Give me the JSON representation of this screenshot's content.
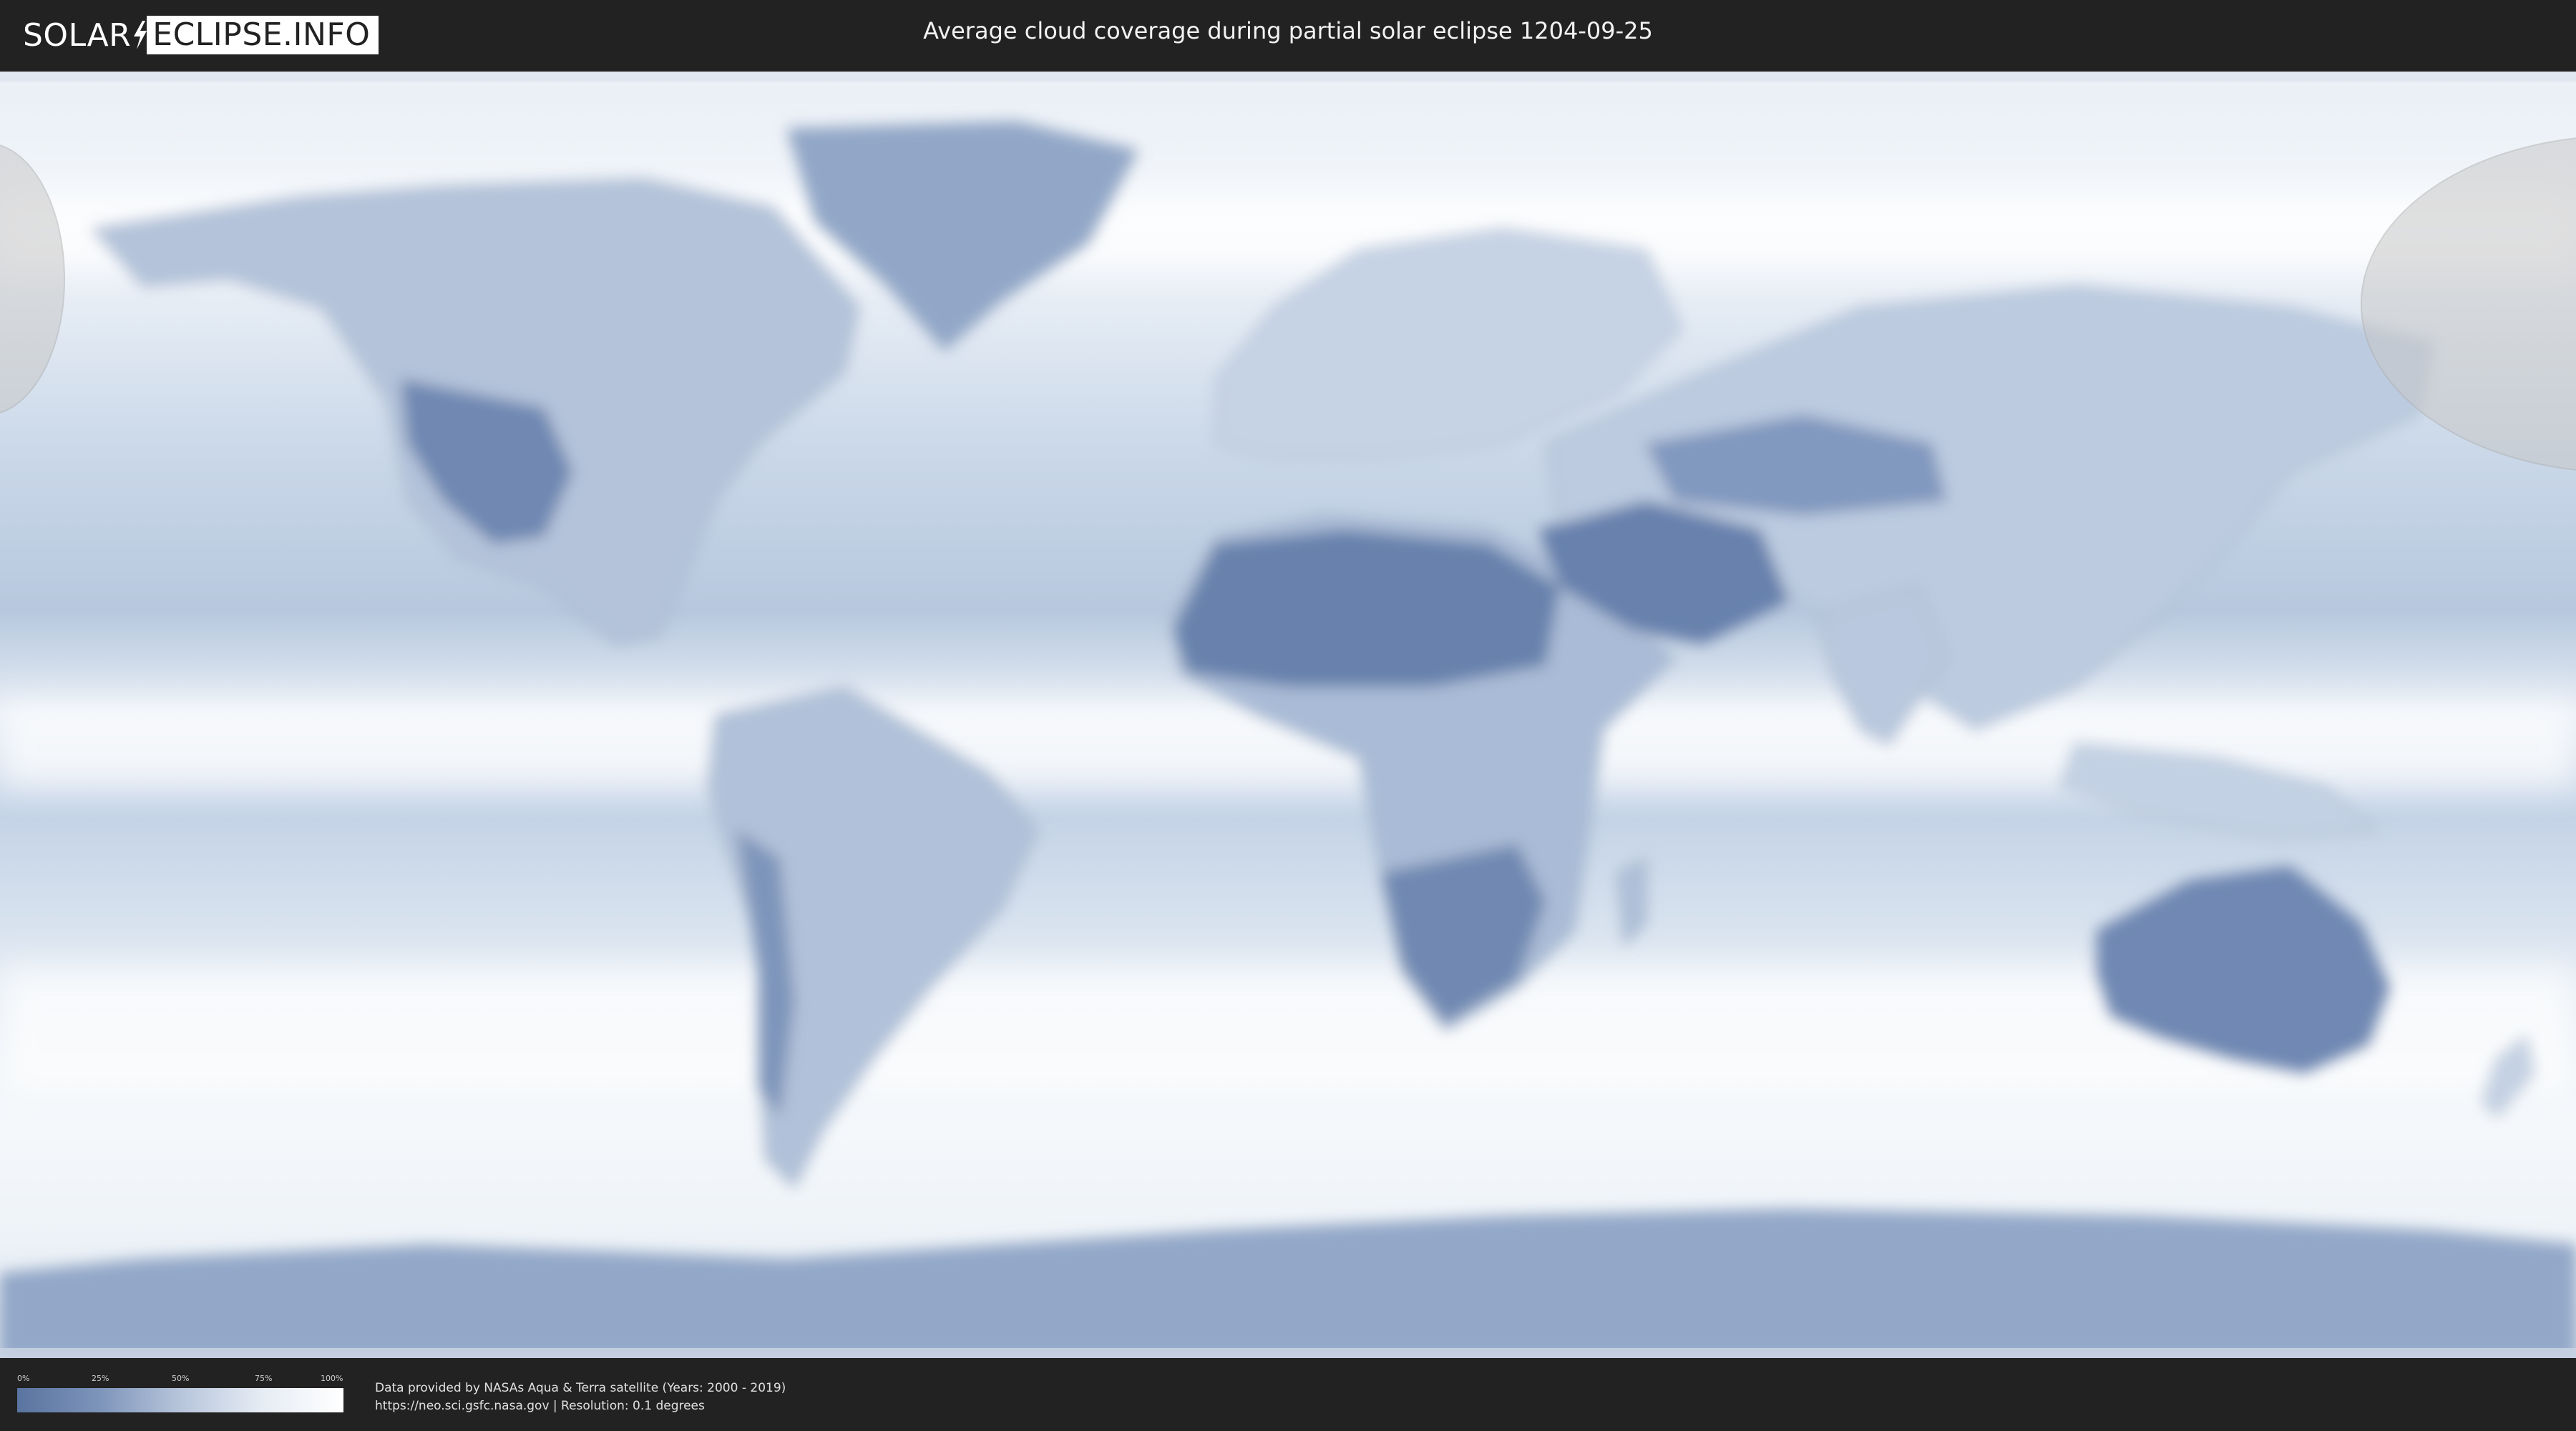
{
  "header": {
    "logo_left": "SOLAR",
    "logo_right": "ECLIPSE.INFO",
    "title": "Average cloud coverage during partial solar eclipse 1204-09-25"
  },
  "legend": {
    "ticks": [
      "0%",
      "25%",
      "50%",
      "75%",
      "100%"
    ],
    "colors": {
      "low": "#5a74a0",
      "high": "#ffffff"
    }
  },
  "footer": {
    "credit_line": "Data provided by NASAs Aqua & Terra satellite (Years: 2000 - 2019)",
    "source_line": "https://neo.sci.gsfc.nasa.gov | Resolution: 0.1 degrees"
  },
  "colors": {
    "background": "#222222",
    "ocean_cloud": "#d6e2ef",
    "clear_land": "#6e86b0",
    "eclipse_shade": "#bfbfbf"
  }
}
